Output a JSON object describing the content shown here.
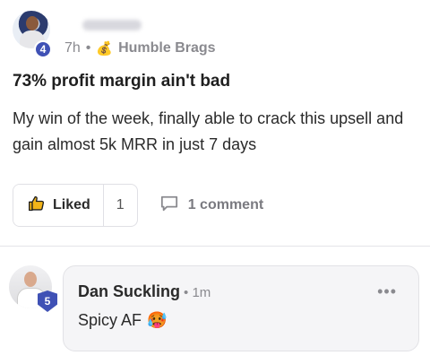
{
  "post": {
    "author_level": "4",
    "time": "7h",
    "separator": "•",
    "category_icon": "money-bag-icon",
    "category_emoji": "💰",
    "category": "Humble Brags",
    "title": "73% profit margin ain't bad",
    "body": "My win of the week, finally able to crack this upsell and gain almost 5k MRR in just 7 days",
    "like_label": "Liked",
    "like_count": "1",
    "comment_label": "1 comment"
  },
  "comment": {
    "author": "Dan Suckling",
    "level": "5",
    "time": "1m",
    "separator": "•",
    "more": "•••",
    "text": "Spicy AF",
    "emoji": "🥵"
  },
  "colors": {
    "accent": "#3f51b5",
    "muted": "#8a8a8f"
  }
}
